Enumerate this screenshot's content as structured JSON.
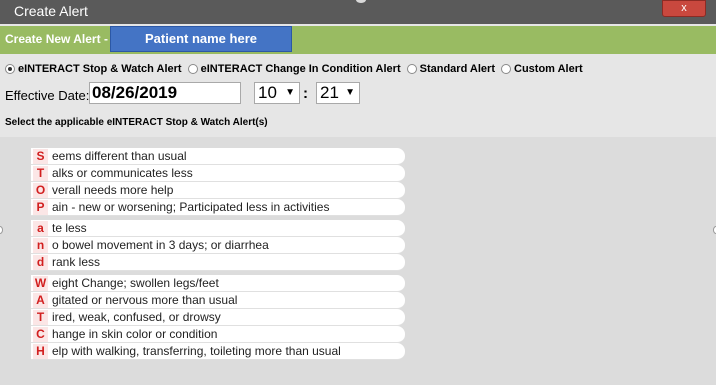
{
  "window": {
    "title": "Create Alert",
    "close_label": "x"
  },
  "header": {
    "section_label": "Create New Alert",
    "dash": "-",
    "patient_name": "Patient name here"
  },
  "alert_types": [
    {
      "label": "eINTERACT Stop & Watch Alert",
      "selected": true
    },
    {
      "label": "eINTERACT Change In Condition Alert",
      "selected": false
    },
    {
      "label": "Standard Alert",
      "selected": false
    },
    {
      "label": "Custom Alert",
      "selected": false
    }
  ],
  "effective": {
    "label": "Effective Date:",
    "date": "08/26/2019",
    "hour": "10",
    "minute": "21",
    "separator": ":",
    "caret": "▼"
  },
  "instruction": "Select the applicable eINTERACT Stop & Watch Alert(s)",
  "stop_and_watch": [
    {
      "letter": "S",
      "text": "eems different than usual"
    },
    {
      "letter": "T",
      "text": "alks or communicates less"
    },
    {
      "letter": "O",
      "text": "verall needs more help"
    },
    {
      "letter": "P",
      "text": "ain - new or worsening; Participated less in activities"
    },
    {
      "letter": "a",
      "text": "te less"
    },
    {
      "letter": "n",
      "text": "o bowel movement in 3 days; or diarrhea"
    },
    {
      "letter": "d",
      "text": "rank less"
    },
    {
      "letter": "W",
      "text": "eight Change; swollen legs/feet"
    },
    {
      "letter": "A",
      "text": "gitated or nervous more than usual"
    },
    {
      "letter": "T",
      "text": "ired, weak, confused, or drowsy"
    },
    {
      "letter": "C",
      "text": "hange in skin color or condition"
    },
    {
      "letter": "H",
      "text": "elp with walking, transferring, toileting more than usual"
    }
  ],
  "colors": {
    "titlebar": "#5a5a5a",
    "header_green": "#99bb62",
    "patient_blue": "#4474c5",
    "letter_red": "#d21f1f"
  }
}
